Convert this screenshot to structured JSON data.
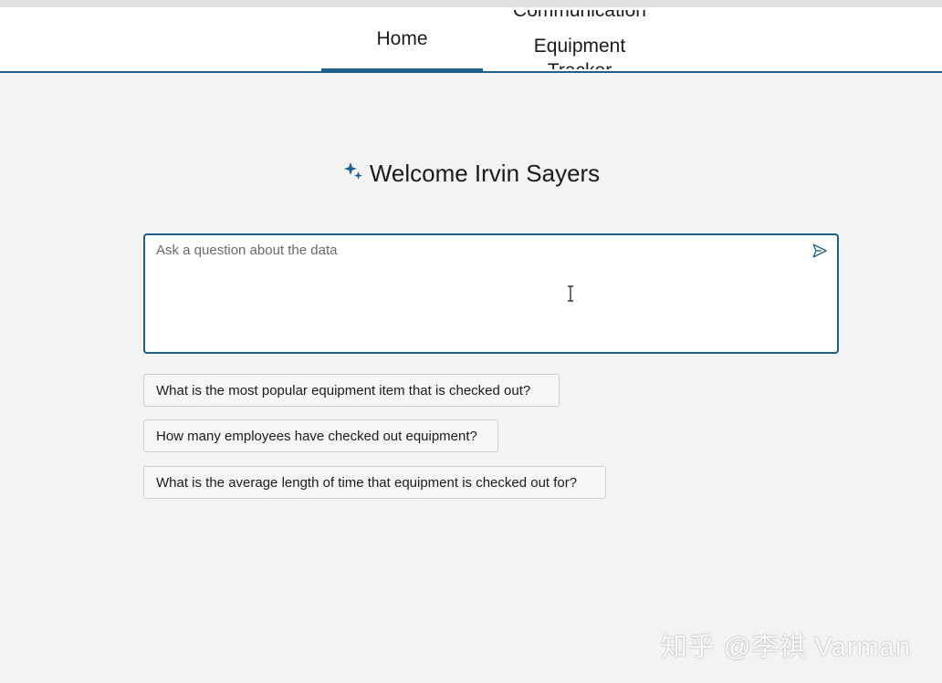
{
  "nav": {
    "tabs": [
      {
        "label": "Home",
        "active": true
      },
      {
        "label_above": "Communication",
        "label": "Equipment",
        "label_below": "Tracker",
        "active": false
      }
    ]
  },
  "welcome": {
    "text": "Welcome Irvin Sayers",
    "icon": "sparkle-icon"
  },
  "ask": {
    "placeholder": "Ask a question about the data",
    "value": "",
    "send_icon": "send-icon"
  },
  "suggestions": [
    "What is the most popular equipment item that is checked out?",
    "How many employees have checked out equipment?",
    "What is the average length of time that equipment is checked out for?"
  ],
  "watermark": "知乎 @李祺 Varman",
  "colors": {
    "accent": "#1f5f8b",
    "background": "#f3f3f3",
    "surface": "#ffffff",
    "sparkle": "#1f5f8b"
  }
}
